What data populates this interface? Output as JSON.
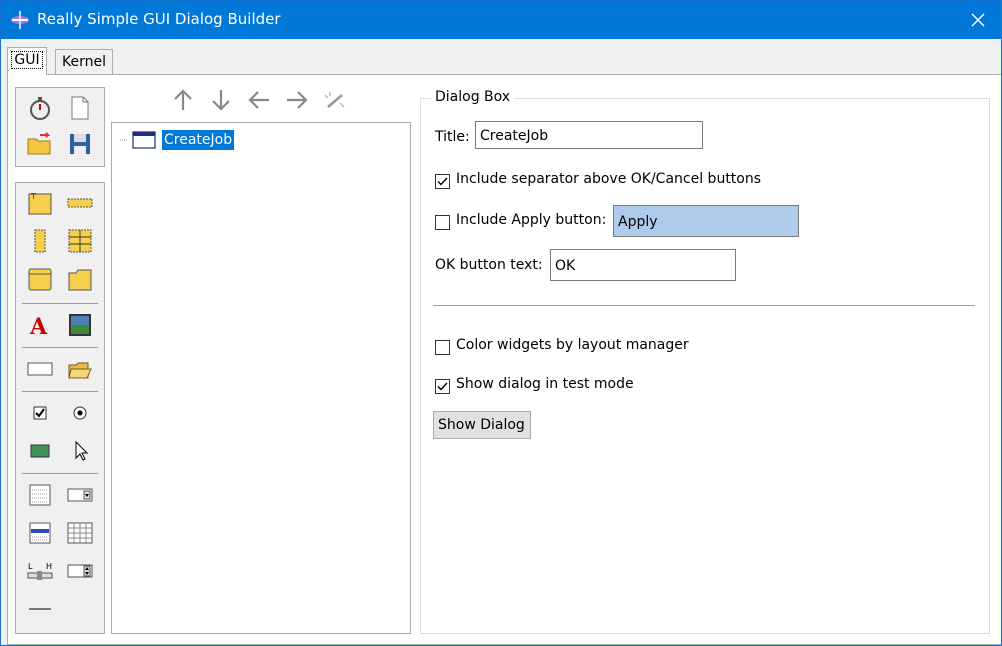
{
  "window": {
    "title": "Really Simple GUI Dialog Builder",
    "app_icon": "rsgdb-app-icon",
    "accent": "#0078d7"
  },
  "tabs": [
    {
      "label": "GUI",
      "active": true
    },
    {
      "label": "Kernel",
      "active": false
    }
  ],
  "palette_file_tools": [
    "stopwatch-icon",
    "new-file-icon",
    "open-folder-icon",
    "save-floppy-icon"
  ],
  "palette_widgets": [
    "titled-frame-icon",
    "row-frame-icon",
    "column-frame-icon",
    "grid-frame-icon",
    "tabbed-frame-icon",
    "folder-frame-icon",
    "label-text-icon",
    "image-icon",
    "text-entry-icon",
    "file-browse-icon",
    "checkbox-icon",
    "radio-button-icon",
    "color-swatch-icon",
    "pointer-icon",
    "listbox-icon",
    "combobox-icon",
    "multiselect-list-icon",
    "table-grid-icon",
    "slider-icon",
    "spinbox-icon",
    "separator-line-icon"
  ],
  "tree_toolbar": [
    "arrow-up-icon",
    "arrow-down-icon",
    "arrow-left-icon",
    "arrow-right-icon",
    "magic-wand-icon"
  ],
  "tree": {
    "root_label": "CreateJob",
    "root_icon": "dialog-window-icon"
  },
  "dialog_box": {
    "legend": "Dialog Box",
    "title_label": "Title:",
    "title_value": "CreateJob",
    "separator_label": "Include separator above OK/Cancel buttons",
    "separator_checked": true,
    "apply_label": "Include Apply button:",
    "apply_checked": false,
    "apply_value": "Apply",
    "ok_label": "OK button text:",
    "ok_value": "OK",
    "color_widgets_label": "Color widgets by layout manager",
    "color_widgets_checked": false,
    "test_mode_label": "Show dialog in test mode",
    "test_mode_checked": true,
    "show_dialog_button": "Show Dialog"
  }
}
